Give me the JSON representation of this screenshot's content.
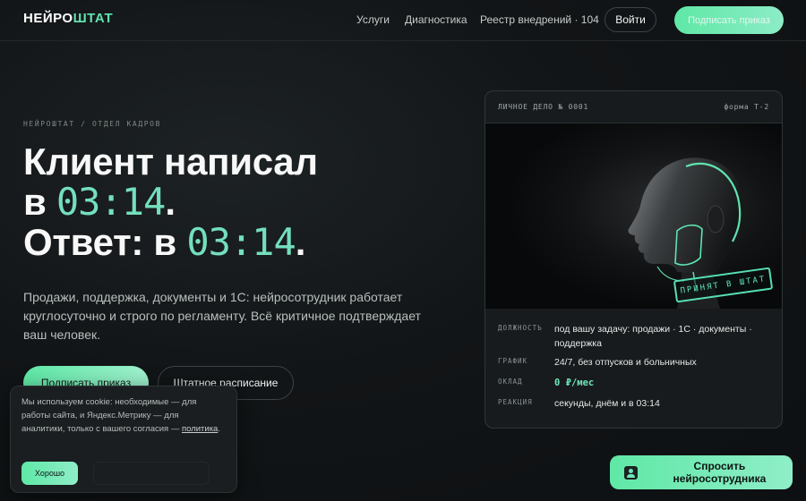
{
  "header": {
    "logo_part1": "НЕЙРО",
    "logo_part2": "ШТАТ",
    "nav": [
      "Услуги",
      "Диагностика",
      "Реестр внедрений · 104"
    ],
    "login_label": "Войти",
    "sign_label": "Подписать приказ"
  },
  "hero": {
    "breadcrumb": "НЕЙРОШТАТ / ОТДЕЛ КАДРОВ",
    "headline_line1": "Клиент написал",
    "headline_line2_prefix": "в ",
    "headline_time1": "03:14",
    "headline_line2_suffix": ".",
    "headline_line3_prefix": "Ответ: в ",
    "headline_time2": "03:14",
    "headline_line3_suffix": ".",
    "lead": "Продажи, поддержка, документы и 1С: нейросотрудник работает круглосуточно и строго по регламенту. Всё критичное подтверждает ваш человек.",
    "btn_sign": "Подписать приказ",
    "btn_staff": "Штатное расписание"
  },
  "card": {
    "file_label": "ЛИЧНОЕ ДЕЛО № 0001",
    "form_label": "форма Т-2",
    "stamp": "ПРИНЯТ В ШТАТ",
    "rows": [
      {
        "label": "ДОЛЖНОСТЬ",
        "value": "под вашу задачу: продажи · 1С · документы · поддержка"
      },
      {
        "label": "ГРАФИК",
        "value": "24/7, без отпусков и больничных"
      },
      {
        "label": "ОКЛАД",
        "value": "0 ₽/мес"
      },
      {
        "label": "РЕАКЦИЯ",
        "value": "секунды, днём и в 03:14"
      }
    ]
  },
  "cookie": {
    "text": "Мы используем cookie: необходимые — для работы сайта, и Яндекс.Метрику — для аналитики, только с вашего согласия —",
    "link": "политика",
    "after_link": ".",
    "ok_label": "Хорошо"
  },
  "ask_bot": {
    "label": "Спросить нейросотрудника",
    "icon": "user-icon"
  },
  "colors": {
    "accent": "#5fe3b0",
    "background": "#121517"
  }
}
